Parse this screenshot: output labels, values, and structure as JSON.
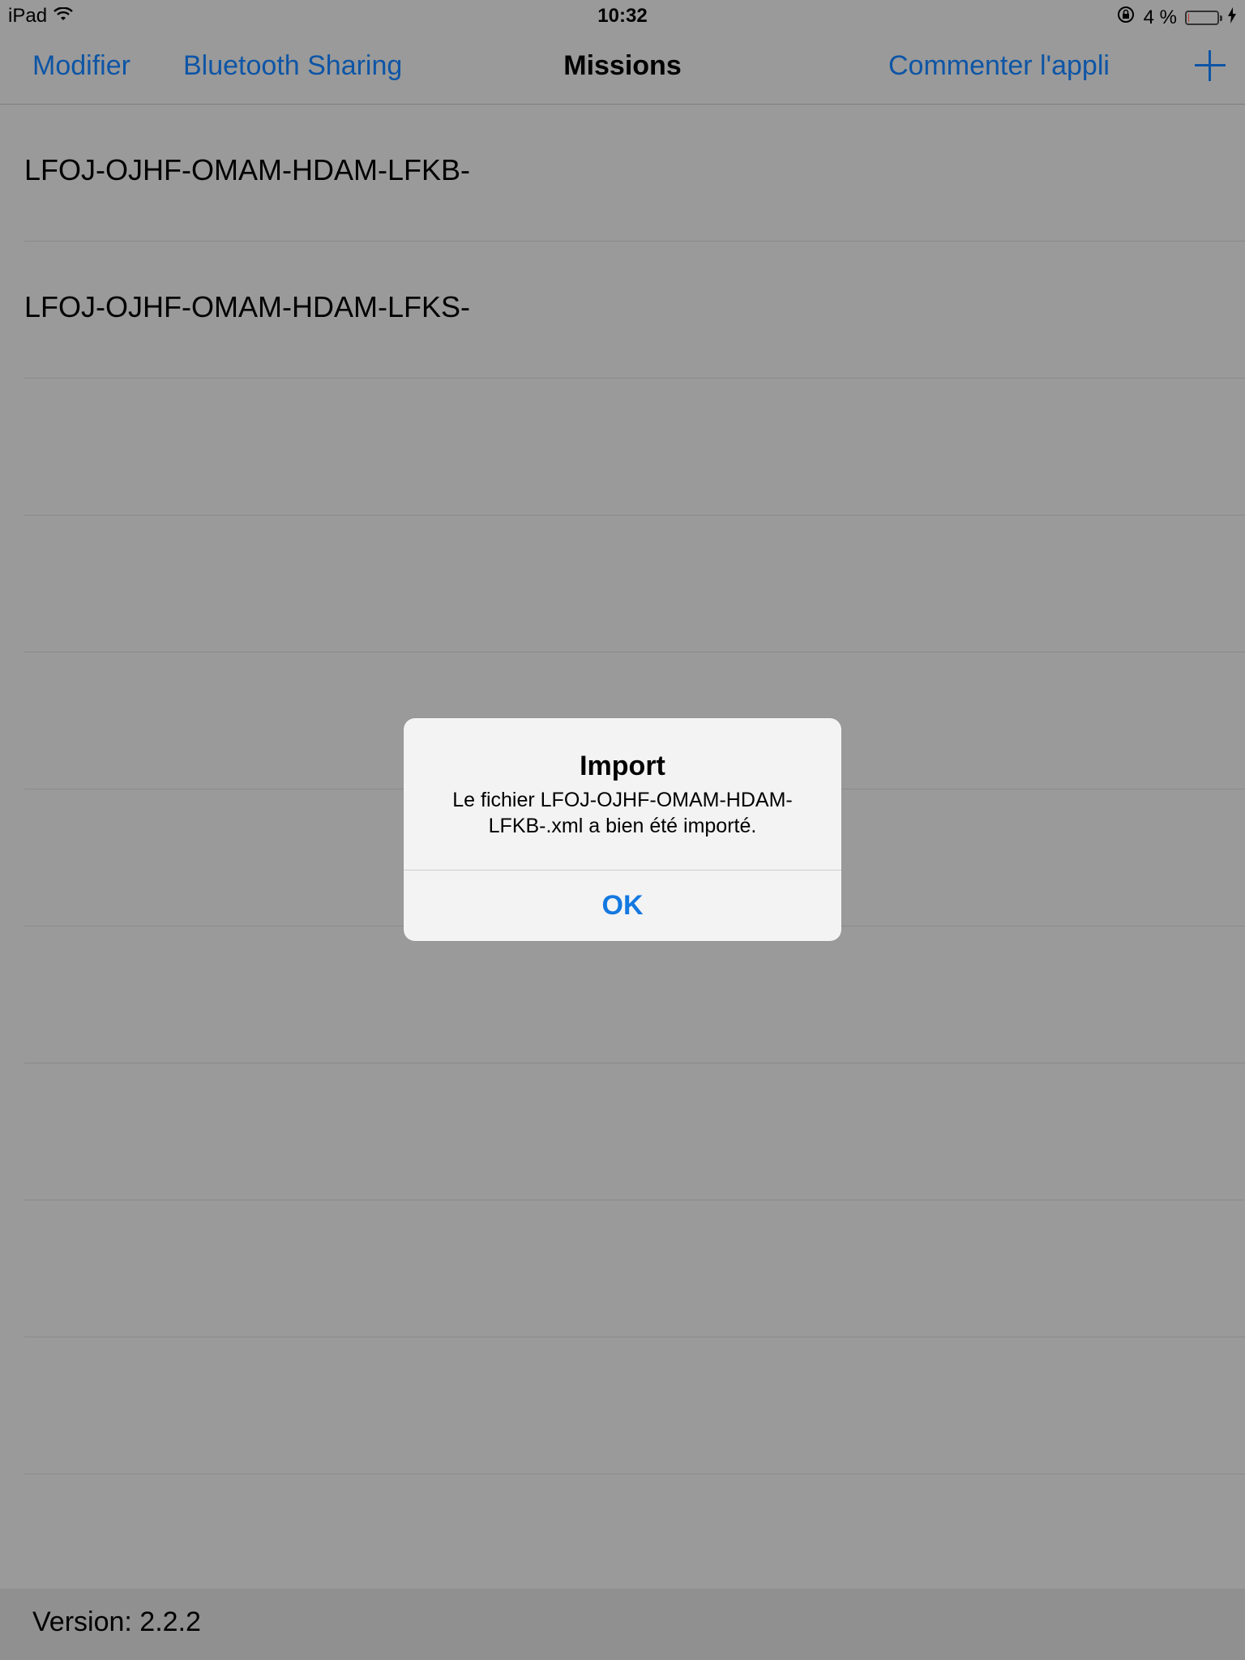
{
  "status_bar": {
    "device": "iPad",
    "time": "10:32",
    "battery_text": "4 %",
    "battery_level": 0.04,
    "icons": [
      "wifi-icon",
      "rotation-lock-icon",
      "battery-icon",
      "charging-icon"
    ]
  },
  "nav": {
    "edit_label": "Modifier",
    "bluetooth_label": "Bluetooth Sharing",
    "title": "Missions",
    "rate_label": "Commenter l'appli",
    "add_icon": "plus-icon"
  },
  "missions": [
    {
      "label": "LFOJ-OJHF-OMAM-HDAM-LFKB-"
    },
    {
      "label": "LFOJ-OJHF-OMAM-HDAM-LFKS-"
    },
    {
      "label": ""
    },
    {
      "label": ""
    },
    {
      "label": ""
    },
    {
      "label": ""
    },
    {
      "label": ""
    },
    {
      "label": ""
    },
    {
      "label": ""
    },
    {
      "label": ""
    }
  ],
  "alert": {
    "title": "Import",
    "message": "Le fichier LFOJ-OJHF-OMAM-HDAM-LFKB-.xml a bien été importé.",
    "button_label": "OK"
  },
  "footer": {
    "version": "Version: 2.2.2"
  },
  "colors": {
    "link": "#0d55a6",
    "alert_button": "#1478e0",
    "background_dimmed": "#9a9a9a",
    "battery_low": "#c0392b"
  }
}
